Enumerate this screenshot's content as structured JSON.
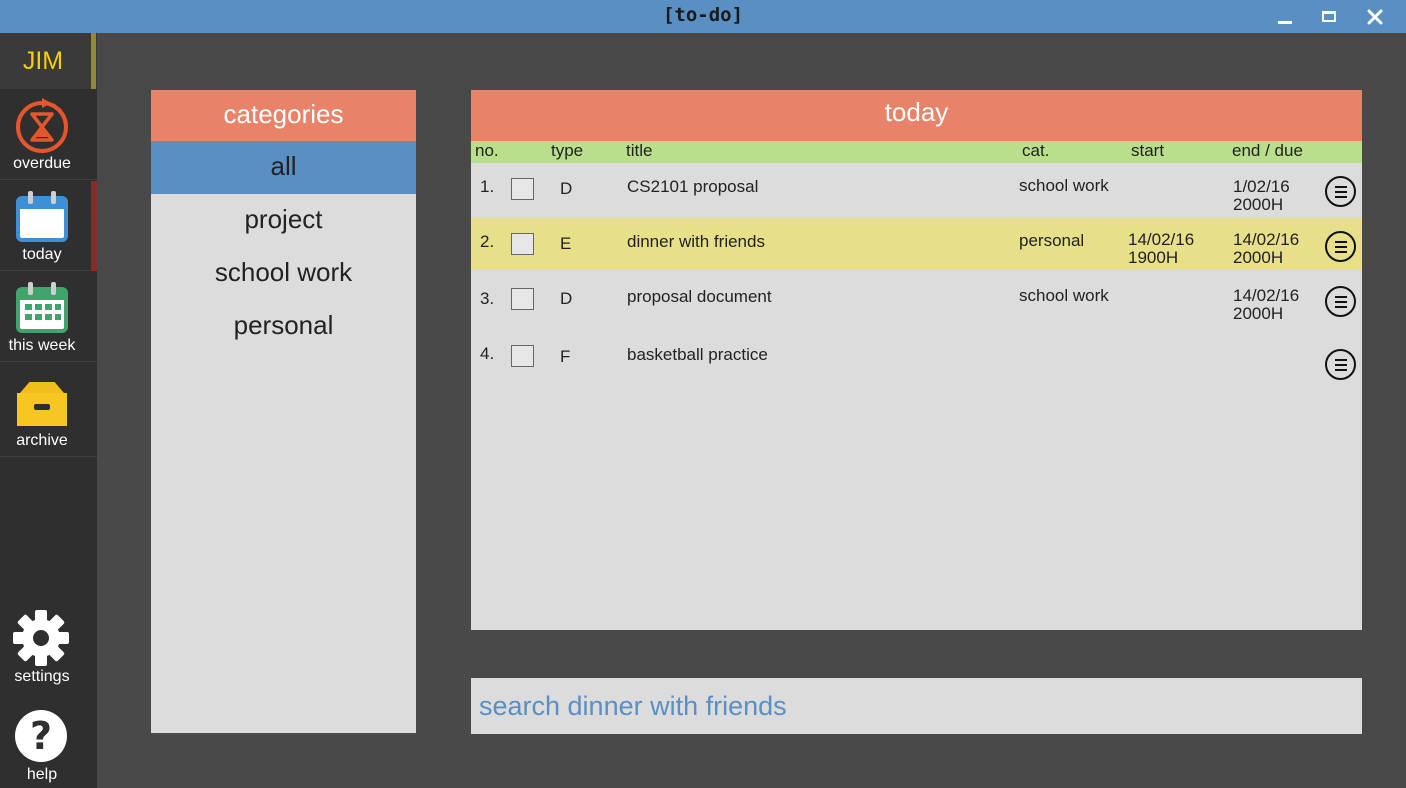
{
  "window": {
    "title": "[to-do]",
    "controls": [
      "minimize-icon",
      "maximize-icon",
      "close-icon"
    ],
    "close_glyph": "✕"
  },
  "colors": {
    "titlebar": "#5a8fc3",
    "panel_header": "#e88268",
    "column_header": "#b9df8c",
    "highlight_row": "#e8df8a",
    "selected_category": "#5a8fc3",
    "user_name": "#f4d000"
  },
  "sidebar": {
    "user": "JIM",
    "nav": [
      {
        "label": "overdue",
        "icon": "hourglass-clock-icon"
      },
      {
        "label": "today",
        "icon": "calendar-day-icon",
        "active": true
      },
      {
        "label": "this week",
        "icon": "calendar-week-icon"
      },
      {
        "label": "archive",
        "icon": "archive-box-icon"
      }
    ],
    "utility": [
      {
        "label": "settings",
        "icon": "gear-icon"
      },
      {
        "label": "help",
        "icon": "question-icon",
        "glyph": "?"
      }
    ]
  },
  "categories": {
    "header": "categories",
    "items": [
      "all",
      "project",
      "school work",
      "personal"
    ],
    "selected": "all"
  },
  "today": {
    "header": "today",
    "columns": {
      "no": "no.",
      "type": "type",
      "title": "title",
      "cat": "cat.",
      "start": "start",
      "end": "end / due"
    },
    "rows": [
      {
        "no": "1.",
        "type": "D",
        "title": "CS2101 proposal",
        "cat": "school work",
        "start_date": "",
        "start_time": "",
        "end_date": "1/02/16",
        "end_time": "2000H",
        "checked": false,
        "highlight": false
      },
      {
        "no": "2.",
        "type": "E",
        "title": "dinner with friends",
        "cat": "personal",
        "start_date": "14/02/16",
        "start_time": "1900H",
        "end_date": "14/02/16",
        "end_time": "2000H",
        "checked": false,
        "highlight": true
      },
      {
        "no": "3.",
        "type": "D",
        "title": "proposal document",
        "cat": "school work",
        "start_date": "",
        "start_time": "",
        "end_date": "14/02/16",
        "end_time": "2000H",
        "checked": false,
        "highlight": false
      },
      {
        "no": "4.",
        "type": "F",
        "title": "basketball practice",
        "cat": "",
        "start_date": "",
        "start_time": "",
        "end_date": "",
        "end_time": "",
        "checked": false,
        "highlight": false
      }
    ]
  },
  "search": {
    "value": "search dinner with friends"
  }
}
